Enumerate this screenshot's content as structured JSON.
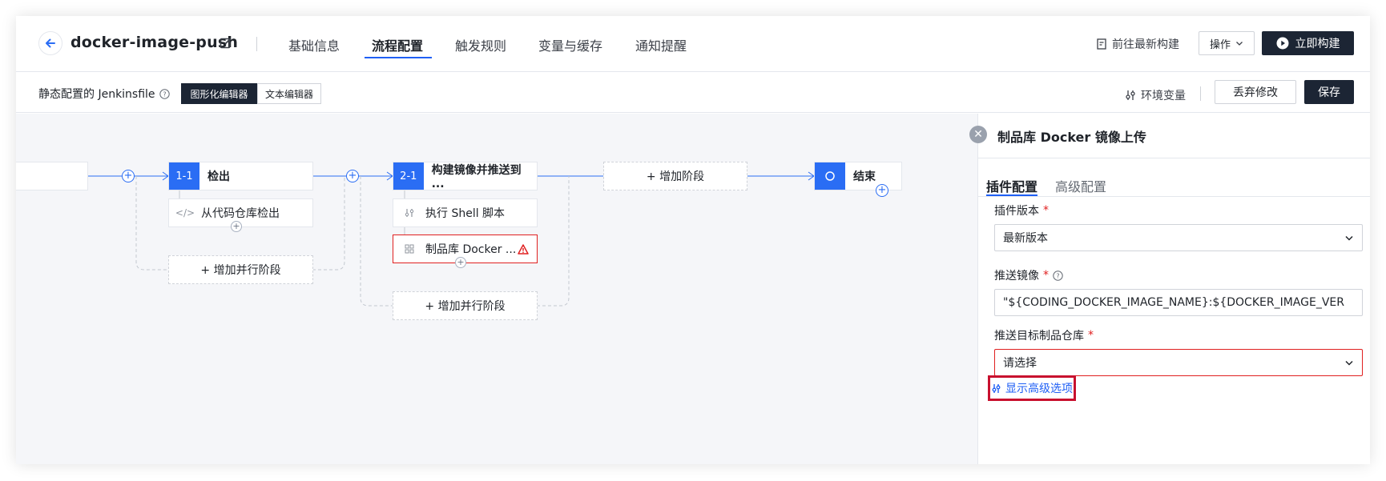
{
  "header": {
    "back_icon": "arrow-left-icon",
    "repo_title": "docker-image-push",
    "tabs": [
      {
        "label": "基础信息"
      },
      {
        "label": "流程配置"
      },
      {
        "label": "触发规则"
      },
      {
        "label": "变量与缓存"
      },
      {
        "label": "通知提醒"
      }
    ],
    "active_tab": "流程配置",
    "latest_build_label": "前往最新构建",
    "ops_label": "操作",
    "build_now_label": "立即构建"
  },
  "subbar": {
    "jenkins_label": "静态配置的 Jenkinsfile",
    "graphic_editor": "图形化编辑器",
    "text_editor": "文本编辑器",
    "env_vars_label": "环境变量",
    "discard_label": "丢弃修改",
    "save_label": "保存"
  },
  "pipeline": {
    "stages": [
      {
        "num": "1-1",
        "name": "检出"
      },
      {
        "num": "2-1",
        "name": "构建镜像并推送到 ..."
      }
    ],
    "steps": [
      {
        "label": "从代码仓库检出"
      },
      {
        "label": "执行 Shell 脚本"
      },
      {
        "label": "制品库 Docker ...",
        "warning": true
      }
    ],
    "add_parallel_label": "+ 增加并行阶段",
    "add_stage_label": "+ 增加阶段",
    "end_label": "结束",
    "accent_color": "#2a6df4",
    "error_color": "#e02020"
  },
  "panel": {
    "title": "制品库 Docker 镜像上传",
    "tabs": [
      {
        "label": "插件配置"
      },
      {
        "label": "高级配置"
      }
    ],
    "plugin_version_label": "插件版本",
    "plugin_version_value": "最新版本",
    "push_image_label": "推送镜像",
    "push_image_value": "\"${CODING_DOCKER_IMAGE_NAME}:${DOCKER_IMAGE_VER",
    "target_repo_label": "推送目标制品仓库",
    "target_repo_placeholder": "请选择",
    "required_mark": "*",
    "show_advanced_label": "显示高级选项"
  }
}
